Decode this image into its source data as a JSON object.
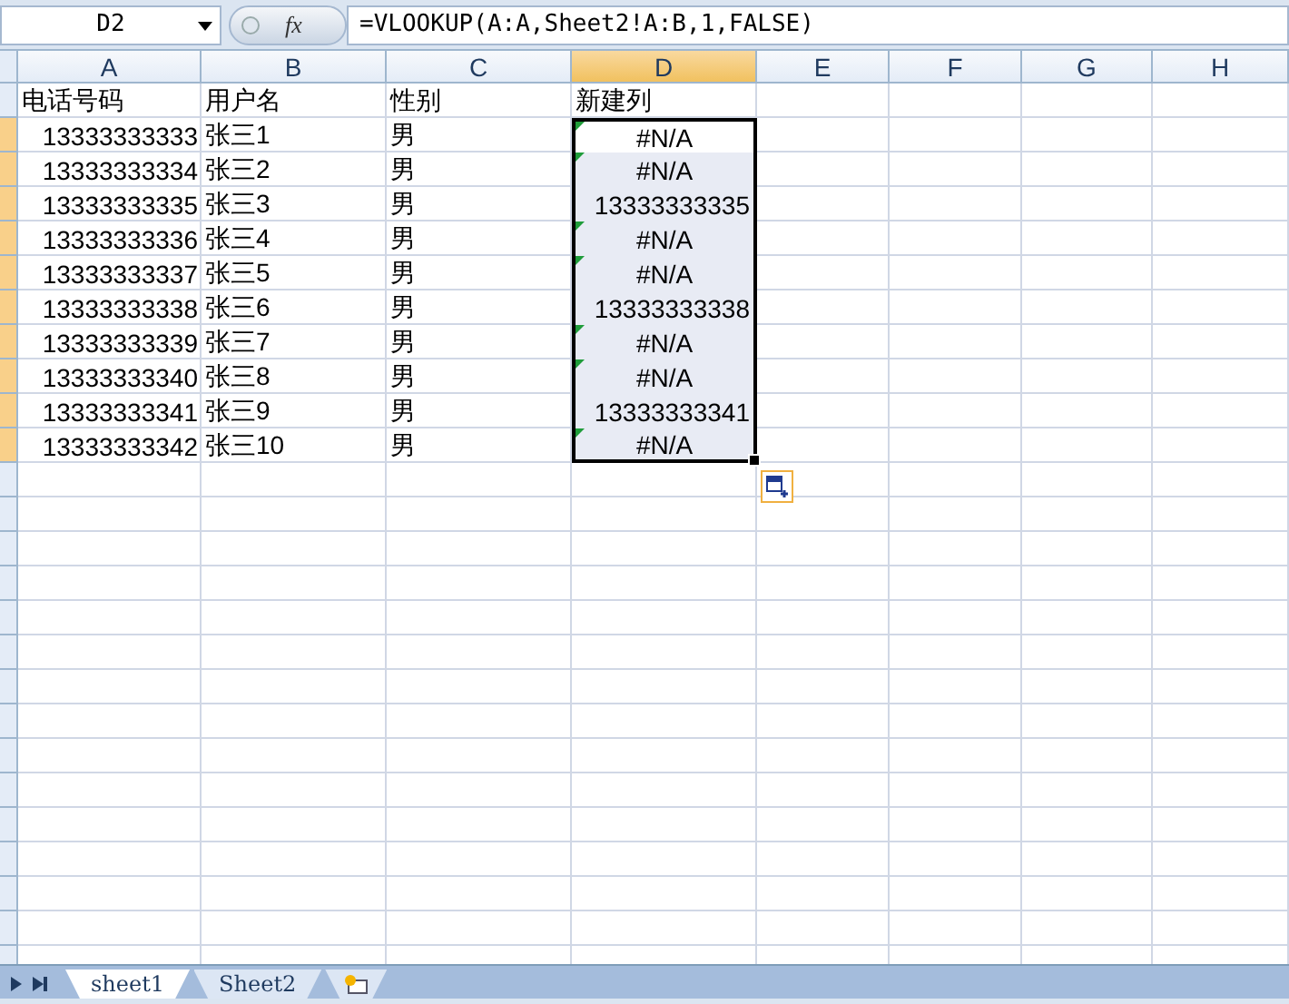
{
  "name_box": "D2",
  "function_label": "fx",
  "formula": "=VLOOKUP(A:A,Sheet2!A:B,1,FALSE)",
  "columns": [
    {
      "label": "A",
      "selected": false
    },
    {
      "label": "B",
      "selected": false
    },
    {
      "label": "C",
      "selected": false
    },
    {
      "label": "D",
      "selected": true
    },
    {
      "label": "E",
      "selected": false
    },
    {
      "label": "F",
      "selected": false
    },
    {
      "label": "G",
      "selected": false
    },
    {
      "label": "H",
      "selected": false
    }
  ],
  "rows": [
    {
      "selected": false,
      "cells": [
        {
          "text": "电话号码",
          "kind": "text"
        },
        {
          "text": "用户名",
          "kind": "text"
        },
        {
          "text": "性别",
          "kind": "text"
        },
        {
          "text": "新建列",
          "kind": "text"
        }
      ]
    },
    {
      "selected": true,
      "cells": [
        {
          "text": "13333333333",
          "kind": "number"
        },
        {
          "text": "张三1",
          "kind": "text"
        },
        {
          "text": "男",
          "kind": "text"
        },
        {
          "text": "#N/A",
          "kind": "error",
          "selected": true,
          "active": true
        }
      ]
    },
    {
      "selected": true,
      "cells": [
        {
          "text": "13333333334",
          "kind": "number"
        },
        {
          "text": "张三2",
          "kind": "text"
        },
        {
          "text": "男",
          "kind": "text"
        },
        {
          "text": "#N/A",
          "kind": "error",
          "selected": true,
          "active": false
        }
      ]
    },
    {
      "selected": true,
      "cells": [
        {
          "text": "13333333335",
          "kind": "number"
        },
        {
          "text": "张三3",
          "kind": "text"
        },
        {
          "text": "男",
          "kind": "text"
        },
        {
          "text": "13333333335",
          "kind": "number",
          "selected": true,
          "active": false
        }
      ]
    },
    {
      "selected": true,
      "cells": [
        {
          "text": "13333333336",
          "kind": "number"
        },
        {
          "text": "张三4",
          "kind": "text"
        },
        {
          "text": "男",
          "kind": "text"
        },
        {
          "text": "#N/A",
          "kind": "error",
          "selected": true,
          "active": false
        }
      ]
    },
    {
      "selected": true,
      "cells": [
        {
          "text": "13333333337",
          "kind": "number"
        },
        {
          "text": "张三5",
          "kind": "text"
        },
        {
          "text": "男",
          "kind": "text"
        },
        {
          "text": "#N/A",
          "kind": "error",
          "selected": true,
          "active": false
        }
      ]
    },
    {
      "selected": true,
      "cells": [
        {
          "text": "13333333338",
          "kind": "number"
        },
        {
          "text": "张三6",
          "kind": "text"
        },
        {
          "text": "男",
          "kind": "text"
        },
        {
          "text": "13333333338",
          "kind": "number",
          "selected": true,
          "active": false
        }
      ]
    },
    {
      "selected": true,
      "cells": [
        {
          "text": "13333333339",
          "kind": "number"
        },
        {
          "text": "张三7",
          "kind": "text"
        },
        {
          "text": "男",
          "kind": "text"
        },
        {
          "text": "#N/A",
          "kind": "error",
          "selected": true,
          "active": false
        }
      ]
    },
    {
      "selected": true,
      "cells": [
        {
          "text": "13333333340",
          "kind": "number"
        },
        {
          "text": "张三8",
          "kind": "text"
        },
        {
          "text": "男",
          "kind": "text"
        },
        {
          "text": "#N/A",
          "kind": "error",
          "selected": true,
          "active": false
        }
      ]
    },
    {
      "selected": true,
      "cells": [
        {
          "text": "13333333341",
          "kind": "number"
        },
        {
          "text": "张三9",
          "kind": "text"
        },
        {
          "text": "男",
          "kind": "text"
        },
        {
          "text": "13333333341",
          "kind": "number",
          "selected": true,
          "active": false
        }
      ]
    },
    {
      "selected": true,
      "cells": [
        {
          "text": "13333333342",
          "kind": "number"
        },
        {
          "text": "张三10",
          "kind": "text"
        },
        {
          "text": "男",
          "kind": "text"
        },
        {
          "text": "#N/A",
          "kind": "error",
          "selected": true,
          "active": false
        }
      ]
    }
  ],
  "sheet_tabs": [
    {
      "label": "sheet1",
      "selected": true
    },
    {
      "label": "Sheet2",
      "selected": false
    }
  ]
}
